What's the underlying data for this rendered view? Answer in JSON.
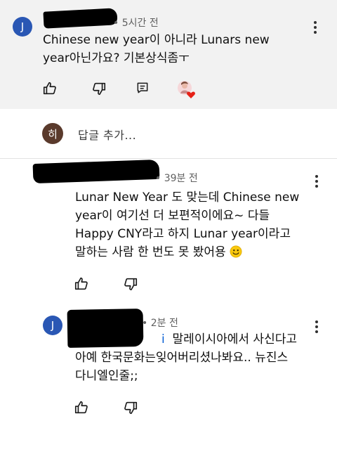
{
  "top_comment": {
    "avatar_letter": "J",
    "avatar_color": "#2a57b4",
    "time": "5시간 전",
    "text_lines": [
      "Chinese new year이 아니라 Lunars new",
      "year아닌가요? 기본상식좀ㅜ"
    ]
  },
  "reply_box": {
    "avatar_letter": "히",
    "avatar_color": "#5a3a2c",
    "placeholder": "답글 추가..."
  },
  "reply1": {
    "time": "39분 전",
    "text_lines": [
      "Lunar New Year 도 맞는데 Chinese new",
      "year이 여기선 더 보편적이에요~ 다들",
      "Happy CNY라고 하지 Lunar year이라고",
      "말하는 사람 한 번도 못 봤어용"
    ]
  },
  "reply2": {
    "avatar_letter": "J",
    "avatar_color": "#2a57b4",
    "time": "2분 전",
    "mention_fragment": "i",
    "text_line1": "말레이시아에서 사신다고",
    "text_lines": [
      "아예 한국문화는잊어버리셨나봐요.. 뉴진스",
      "다니엘인줄;;"
    ]
  },
  "icons": {
    "like": "thumbs-up-icon",
    "dislike": "thumbs-down-icon",
    "reply": "reply-comment-icon",
    "more": "more-vertical-icon",
    "creator_heart": "creator-heart-icon",
    "emoji": "smiling-face-emoji",
    "heart_color": "#e62117",
    "mention_color": "#065fd4"
  }
}
